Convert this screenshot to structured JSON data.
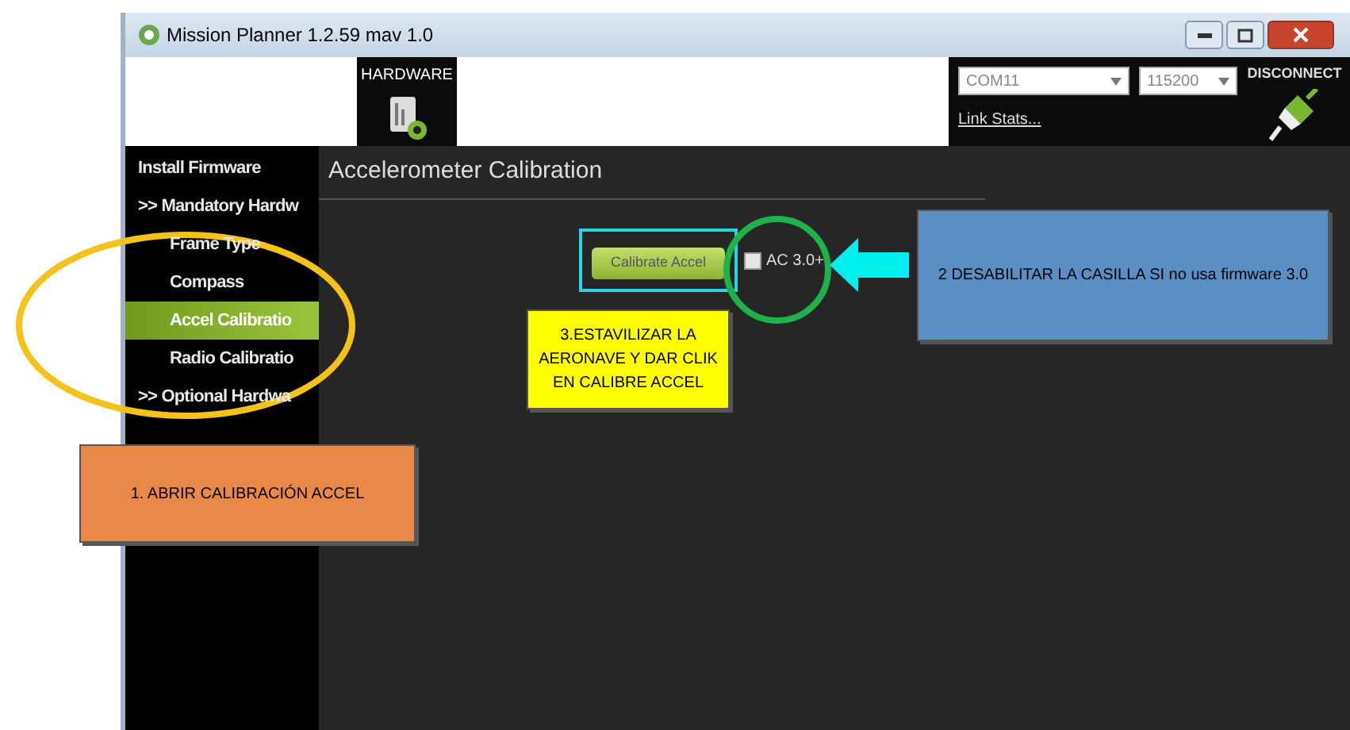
{
  "window": {
    "title": "Mission Planner 1.2.59 mav 1.0"
  },
  "toolbar": {
    "hardware_label": "HARDWARE",
    "port": "COM11",
    "baud": "115200",
    "link_stats": "Link Stats...",
    "connect_label": "DISCONNECT"
  },
  "sidebar": {
    "items": [
      {
        "label": "Install Firmware",
        "kind": "top",
        "selected": false
      },
      {
        "label": ">> Mandatory Hardw",
        "kind": "top",
        "selected": false
      },
      {
        "label": "Frame Type",
        "kind": "sub",
        "selected": false
      },
      {
        "label": "Compass",
        "kind": "sub",
        "selected": false
      },
      {
        "label": "Accel Calibratio",
        "kind": "sub",
        "selected": true
      },
      {
        "label": "Radio Calibratio",
        "kind": "sub",
        "selected": false
      },
      {
        "label": ">> Optional Hardwa",
        "kind": "top",
        "selected": false
      }
    ]
  },
  "panel": {
    "title": "Accelerometer Calibration",
    "calibrate_button": "Calibrate Accel",
    "ac3_checkbox": {
      "label": "AC 3.0+",
      "checked": false
    }
  },
  "annotations": [
    {
      "kind": "note",
      "text": "1. ABRIR CALIBRACIÓN ACCEL",
      "color": "#e8894a"
    },
    {
      "kind": "note",
      "text": "2 DESABILITAR LA CASILLA SI no usa firmware 3.0",
      "color": "#5b8ec4"
    },
    {
      "kind": "note",
      "text": "3.ESTAVILIZAR LA AERONAVE Y DAR CLIK EN CALIBRE ACCEL",
      "color": "#ffff00"
    }
  ]
}
